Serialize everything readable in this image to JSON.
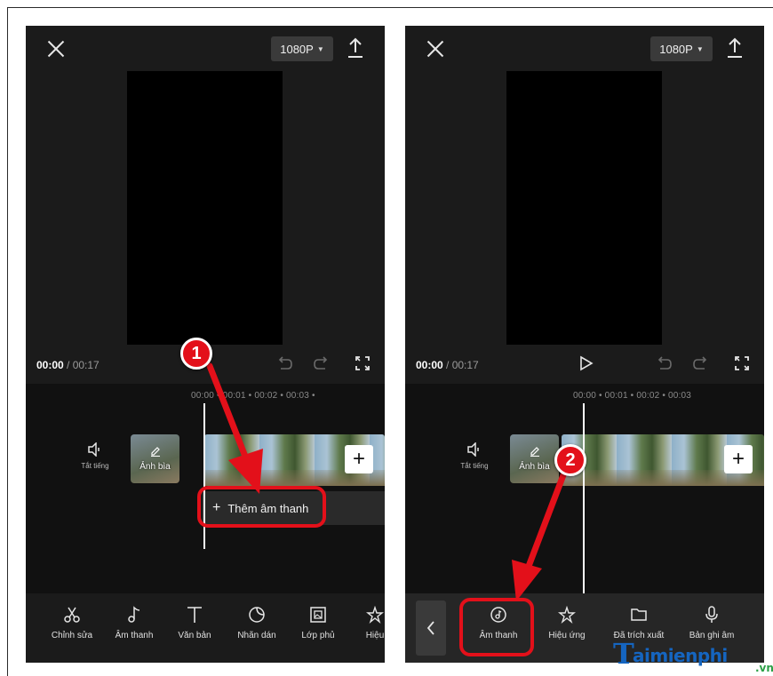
{
  "left_phone": {
    "resolution": "1080P",
    "time_current": "00:00",
    "time_total": " / 00:17",
    "ruler": "00:00   •   00:01   •   00:02   •   00:03   •",
    "mute_label": "Tắt tiếng",
    "cover_label": "Ảnh bìa",
    "add_audio_label": "Thêm âm thanh",
    "step_badge": "1",
    "toolbar": [
      {
        "icon": "scissors-icon",
        "label": "Chỉnh sửa"
      },
      {
        "icon": "music-note-icon",
        "label": "Âm thanh"
      },
      {
        "icon": "text-icon",
        "label": "Văn bản"
      },
      {
        "icon": "sticker-icon",
        "label": "Nhãn dán"
      },
      {
        "icon": "overlay-icon",
        "label": "Lớp phủ"
      },
      {
        "icon": "effects-icon",
        "label": "Hiệu"
      }
    ]
  },
  "right_phone": {
    "resolution": "1080P",
    "time_current": "00:00",
    "time_total": " / 00:17",
    "ruler": "00:00   •   00:01   •   00:02   •   00:03",
    "mute_label": "Tắt tiếng",
    "cover_label": "Ảnh bìa",
    "step_badge": "2",
    "toolbar": [
      {
        "icon": "music-disc-icon",
        "label": "Âm thanh"
      },
      {
        "icon": "effects-icon",
        "label": "Hiệu ứng"
      },
      {
        "icon": "folder-icon",
        "label": "Đã trích xuất"
      },
      {
        "icon": "microphone-icon",
        "label": "Bản ghi âm"
      }
    ]
  },
  "watermark": {
    "letter": "T",
    "name": "aimienphi",
    "suffix": ".vn"
  },
  "colors": {
    "highlight": "#e3101a",
    "phone_bg": "#1b1b1b",
    "watermark_blue": "#1565c0",
    "watermark_green": "#2aa046"
  }
}
